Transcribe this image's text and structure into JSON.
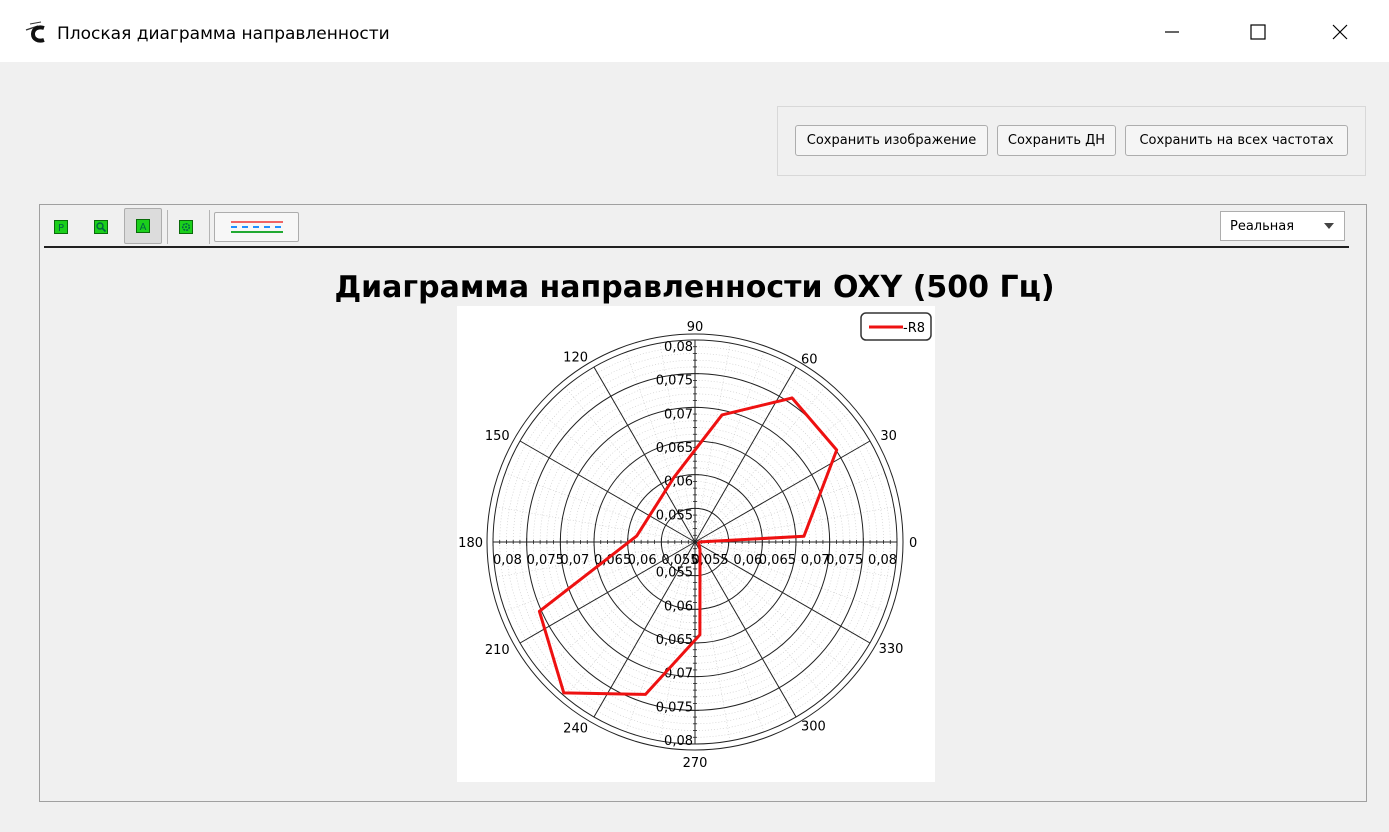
{
  "window": {
    "title": "Плоская диаграмма направленности",
    "icon": "app-logo-icon",
    "controls": [
      "minimize-icon",
      "maximize-icon",
      "close-icon"
    ]
  },
  "buttons": {
    "save_image": "Сохранить изображение",
    "save_pattern": "Сохранить ДН",
    "save_all_freq": "Сохранить на всех частотах"
  },
  "toolbar": {
    "tools": [
      {
        "name": "tool-p-icon",
        "letter": "P"
      },
      {
        "name": "tool-zoom-icon",
        "letter": ""
      },
      {
        "name": "tool-a-icon",
        "letter": "A",
        "active": true
      },
      {
        "name": "tool-gear-icon",
        "letter": ""
      }
    ],
    "line_style_icon": "line-style-icon",
    "mode_value": "Реальная"
  },
  "colors": {
    "series": "#ee1111",
    "tool_green": "#1bcf1b",
    "accent_blue": "#1e90ff"
  },
  "chart_data": {
    "type": "polar",
    "title": "Диаграмма направленности OXY (500 Гц)",
    "angle_unit": "deg",
    "angle_labels": [
      "0",
      "30",
      "60",
      "90",
      "120",
      "150",
      "180",
      "210",
      "240",
      "270",
      "300",
      "330"
    ],
    "radial_range": [
      0.05,
      0.08
    ],
    "radial_ticks": [
      "0,055",
      "0,06",
      "0,065",
      "0,07",
      "0,075",
      "0,08"
    ],
    "grid": true,
    "legend_position": "top-right",
    "series": [
      {
        "name": "R8",
        "points": [
          {
            "angle": 0,
            "r": 0.0505
          },
          {
            "angle": 3,
            "r": 0.0662
          },
          {
            "angle": 33,
            "r": 0.0751
          },
          {
            "angle": 56,
            "r": 0.0758
          },
          {
            "angle": 78,
            "r": 0.0693
          },
          {
            "angle": 108,
            "r": 0.0601
          },
          {
            "angle": 174,
            "r": 0.0587
          },
          {
            "angle": 204,
            "r": 0.0753
          },
          {
            "angle": 229,
            "r": 0.0797
          },
          {
            "angle": 252,
            "r": 0.0738
          },
          {
            "angle": 273,
            "r": 0.0638
          },
          {
            "angle": 305,
            "r": 0.0513
          },
          {
            "angle": 360,
            "r": 0.0505
          }
        ]
      }
    ]
  }
}
